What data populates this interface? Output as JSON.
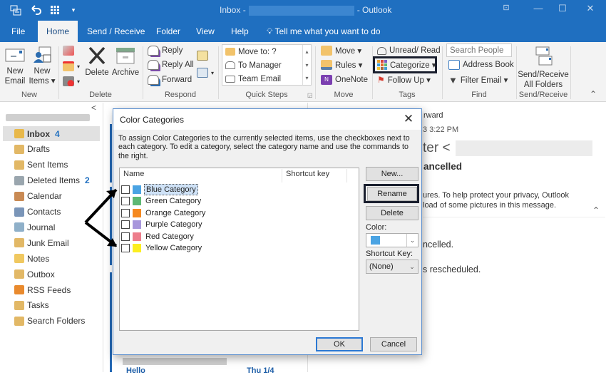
{
  "window": {
    "title_prefix": "Inbox -",
    "title_suffix": "- Outlook",
    "qat": {
      "save_icon": "send-receive-icon",
      "undo_icon": "undo-icon",
      "apps_icon": "apps-icon",
      "customize": "▾"
    },
    "controls": {
      "ribbon_display": "⊡",
      "minimize": "—",
      "maximize": "☐",
      "close": "✕"
    }
  },
  "menu": {
    "tabs": [
      {
        "label": "File"
      },
      {
        "label": "Home",
        "active": true
      },
      {
        "label": "Send / Receive"
      },
      {
        "label": "Folder"
      },
      {
        "label": "View"
      },
      {
        "label": "Help"
      }
    ],
    "tell_me": "Tell me what you want to do"
  },
  "ribbon": {
    "new": {
      "label": "New",
      "new_email": [
        "New",
        "Email"
      ],
      "new_items": [
        "New",
        "Items ▾"
      ]
    },
    "delete": {
      "label": "Delete",
      "delete_btn": "Delete",
      "archive_btn": "Archive"
    },
    "respond": {
      "label": "Respond",
      "reply": "Reply",
      "reply_all": "Reply All",
      "forward": "Forward"
    },
    "quick_steps": {
      "label": "Quick Steps",
      "items": [
        "Move to: ?",
        "To Manager",
        "Team Email"
      ]
    },
    "move": {
      "label": "Move",
      "move": "Move ▾",
      "rules": "Rules ▾",
      "onenote": "OneNote"
    },
    "tags": {
      "label": "Tags",
      "unread_read": "Unread/ Read",
      "categorize": "Categorize ▾",
      "follow_up": "Follow Up ▾"
    },
    "find": {
      "label": "Find",
      "search_placeholder": "Search People",
      "address_book": "Address Book",
      "filter_email": "Filter Email ▾"
    },
    "send_receive": {
      "label": "Send/Receive",
      "btn": [
        "Send/Receive",
        "All Folders"
      ]
    },
    "collapse": "⌃"
  },
  "sidebar": {
    "collapse": "<",
    "folders": [
      {
        "label": "Inbox",
        "count": "4",
        "selected": true,
        "icon": "inbox-icon",
        "color": "#e8b84a"
      },
      {
        "label": "Drafts",
        "count": "",
        "icon": "drafts-icon",
        "color": "#e2b866"
      },
      {
        "label": "Sent Items",
        "count": "",
        "icon": "sent-items-icon",
        "color": "#e2b866"
      },
      {
        "label": "Deleted Items",
        "count": "2",
        "icon": "trash-icon",
        "color": "#9aa6ae"
      },
      {
        "label": "Calendar",
        "count": "",
        "icon": "calendar-icon",
        "color": "#c98a54"
      },
      {
        "label": "Contacts",
        "count": "",
        "icon": "contacts-icon",
        "color": "#7a95b8"
      },
      {
        "label": "Journal",
        "count": "",
        "icon": "journal-icon",
        "color": "#8fb0c9"
      },
      {
        "label": "Junk Email",
        "count": "",
        "icon": "junk-icon",
        "color": "#e2b866"
      },
      {
        "label": "Notes",
        "count": "",
        "icon": "notes-icon",
        "color": "#f0c860"
      },
      {
        "label": "Outbox",
        "count": "",
        "icon": "outbox-icon",
        "color": "#e2b866"
      },
      {
        "label": "RSS Feeds",
        "count": "",
        "icon": "rss-icon",
        "color": "#e98a2e"
      },
      {
        "label": "Tasks",
        "count": "",
        "icon": "tasks-icon",
        "color": "#e2b866"
      },
      {
        "label": "Search Folders",
        "count": "",
        "icon": "search-folder-icon",
        "color": "#e2b866"
      }
    ]
  },
  "message_list": {
    "bottom_subject": "Hello",
    "bottom_date": "Thu 1/4"
  },
  "reading_pane": {
    "forward_text": "rward",
    "time_text": "3 3:22 PM",
    "from_text": "ter <",
    "subject_text": "ancelled",
    "privacy_line1": "ures. To help protect your privacy, Outlook",
    "privacy_line2": "load of some pictures in this message.",
    "body_line1": "ncelled.",
    "body_line2": "s rescheduled."
  },
  "dialog": {
    "title": "Color Categories",
    "instructions": "To assign Color Categories to the currently selected items, use the checkboxes next to each category.  To edit a category, select the category name and use the commands to the right.",
    "columns": {
      "name": "Name",
      "shortcut": "Shortcut key"
    },
    "categories": [
      {
        "name": "Blue Category",
        "color": "#4aa3e3",
        "checked": false,
        "selected": true
      },
      {
        "name": "Green Category",
        "color": "#5db873",
        "checked": false
      },
      {
        "name": "Orange Category",
        "color": "#f5891f",
        "checked": false
      },
      {
        "name": "Purple Category",
        "color": "#a897dc",
        "checked": false
      },
      {
        "name": "Red Category",
        "color": "#ed7d8b",
        "checked": false
      },
      {
        "name": "Yellow Category",
        "color": "#fcee21",
        "checked": false
      }
    ],
    "buttons": {
      "new": "New...",
      "rename": "Rename",
      "delete": "Delete",
      "ok": "OK",
      "cancel": "Cancel"
    },
    "color_label": "Color:",
    "color_value": "#4aa3e3",
    "shortcut_label": "Shortcut Key:",
    "shortcut_value": "(None)",
    "close": "✕"
  }
}
